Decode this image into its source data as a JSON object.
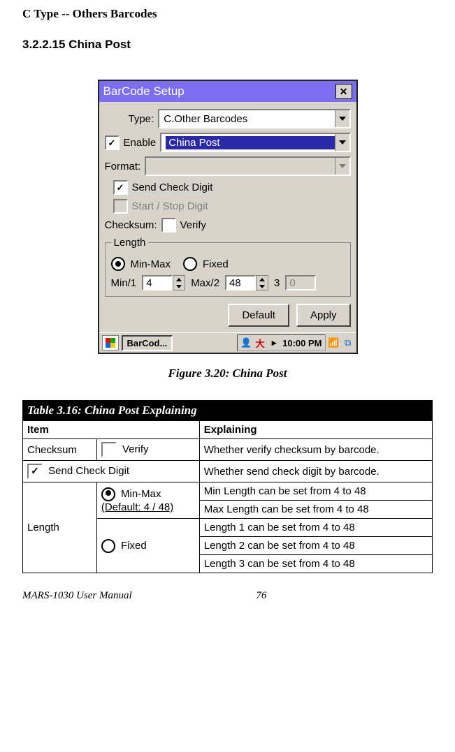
{
  "heading1": "C Type -- Others Barcodes",
  "heading2": "3.2.2.15 China Post",
  "figure_caption": "Figure 3.20: China Post",
  "window": {
    "title": "BarCode Setup",
    "type_label": "Type:",
    "type_value": "C.Other Barcodes",
    "enable_label": "Enable",
    "enable_checked": true,
    "subtype_value": "China Post",
    "format_label": "Format:",
    "send_check_label": "Send Check Digit",
    "send_check_checked": true,
    "startstop_label": "Start / Stop Digit",
    "checksum_label": "Checksum:",
    "verify_label": "Verify",
    "length_legend": "Length",
    "minmax_label": "Min-Max",
    "fixed_label": "Fixed",
    "min_label": "Min/1",
    "min_val": "4",
    "max_label": "Max/2",
    "max_val": "48",
    "three_label": "3",
    "three_val": "0",
    "btn_default": "Default",
    "btn_apply": "Apply",
    "task_app": "BarCod...",
    "clock": "10:00 PM"
  },
  "table": {
    "title": "Table 3.16: China Post Explaining",
    "col_item": "Item",
    "col_expl": "Explaining",
    "checksum": "Checksum",
    "verify": "Verify",
    "verify_expl": "Whether verify checksum by barcode.",
    "sendchk": "Send Check Digit",
    "sendchk_expl": "Whether send check digit by barcode.",
    "length": "Length",
    "minmax": "Min-Max",
    "minmax_default": "(Default: 4 / 48)",
    "min_expl": "Min Length can be set from 4 to 48",
    "max_expl": "Max Length can be set from 4 to 48",
    "fixed": "Fixed",
    "l1": "Length 1 can be set from 4 to 48",
    "l2": "Length 2 can be set from 4 to 48",
    "l3": "Length 3 can be set from 4 to 48"
  },
  "footer": {
    "book": "MARS-1030 User Manual",
    "page": "76"
  }
}
